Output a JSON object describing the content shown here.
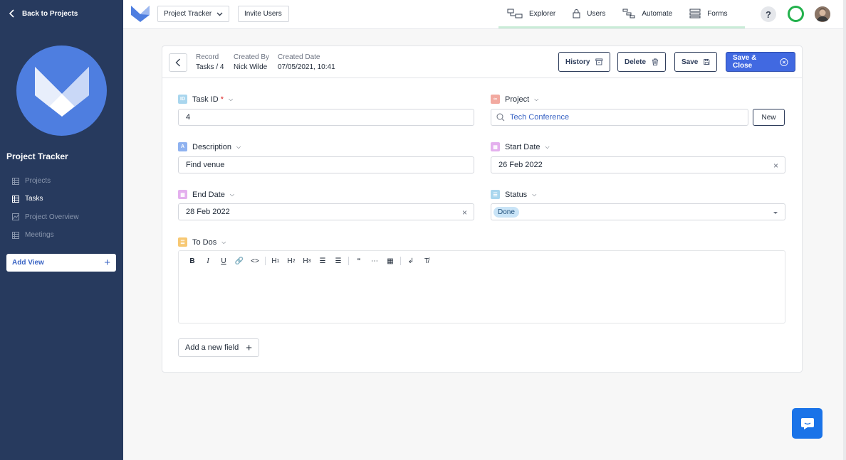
{
  "sidebar": {
    "back_label": "Back to Projects",
    "project_title": "Project Tracker",
    "items": [
      {
        "label": "Projects",
        "icon": "table-icon"
      },
      {
        "label": "Tasks",
        "icon": "table-icon"
      },
      {
        "label": "Project Overview",
        "icon": "gallery-icon"
      },
      {
        "label": "Meetings",
        "icon": "table-icon"
      }
    ],
    "active_item": "Tasks",
    "add_view_label": "Add View"
  },
  "topbar": {
    "project_selector": "Project Tracker",
    "invite_label": "Invite Users",
    "nav": [
      {
        "label": "Explorer",
        "icon": "explorer-icon"
      },
      {
        "label": "Users",
        "icon": "lock-icon"
      },
      {
        "label": "Automate",
        "icon": "automate-icon"
      },
      {
        "label": "Forms",
        "icon": "forms-icon"
      }
    ],
    "help_label": "?"
  },
  "record_header": {
    "record_label": "Record",
    "record_value": "Tasks / 4",
    "created_by_label": "Created By",
    "created_by_value": "Nick Wilde",
    "created_date_label": "Created Date",
    "created_date_value": "07/05/2021, 10:41",
    "history_label": "History",
    "delete_label": "Delete",
    "save_label": "Save",
    "save_close_label": "Save & Close"
  },
  "fields": {
    "task_id": {
      "label": "Task ID",
      "required_mark": "*",
      "icon_text": "ID",
      "value": "4"
    },
    "project": {
      "label": "Project",
      "value": "Tech Conference",
      "new_label": "New"
    },
    "description": {
      "label": "Description",
      "icon_text": "A",
      "value": "Find venue"
    },
    "start_date": {
      "label": "Start Date",
      "value": "26 Feb 2022"
    },
    "end_date": {
      "label": "End Date",
      "value": "28 Feb 2022"
    },
    "status": {
      "label": "Status",
      "value": "Done"
    },
    "todos": {
      "label": "To Dos"
    }
  },
  "editor_toolbar": [
    "B",
    "I",
    "U",
    "link",
    "code",
    "H1",
    "H2",
    "H3",
    "bullet-list",
    "numbered-list",
    "quote",
    "divider",
    "table",
    "wrap",
    "clear-format"
  ],
  "add_field_label": "Add a new field",
  "colors": {
    "sidebar_bg": "#273a5e",
    "primary": "#4169e1",
    "status_done_bg": "#c9e4f7",
    "chat_button": "#1a73e8"
  }
}
